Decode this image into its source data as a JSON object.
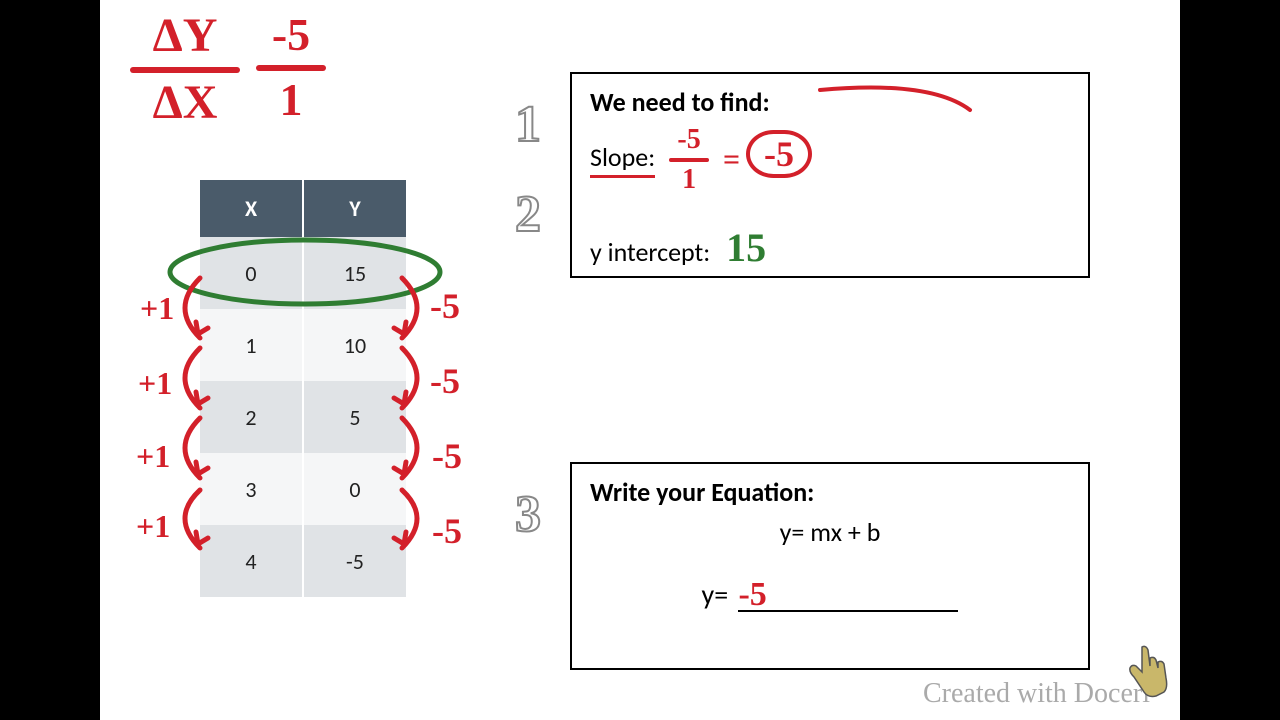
{
  "topLeftFraction": {
    "num1": "ΔY",
    "den1": "ΔX",
    "num2": "-5",
    "den2": "1"
  },
  "table": {
    "headers": {
      "x": "X",
      "y": "Y"
    },
    "rows": [
      {
        "x": "0",
        "y": "15"
      },
      {
        "x": "1",
        "y": "10"
      },
      {
        "x": "2",
        "y": "5"
      },
      {
        "x": "3",
        "y": "0"
      },
      {
        "x": "4",
        "y": "-5"
      }
    ]
  },
  "leftDeltas": [
    "+1",
    "+1",
    "+1",
    "+1"
  ],
  "rightDeltas": [
    "-5",
    "-5",
    "-5",
    "-5"
  ],
  "steps": {
    "one": "1",
    "two": "2",
    "three": "3"
  },
  "box1": {
    "title": "We need to find:",
    "slopeLabel": "Slope:",
    "slopeNum": "-5",
    "slopeDen": "1",
    "equals": "=",
    "slopeAnswer": "-5",
    "yIntLabel": "y intercept:",
    "yIntValue": "15"
  },
  "box3": {
    "title": "Write your Equation:",
    "line1": "y= mx + b",
    "line2prefix": "y= ",
    "line2answer": "-5"
  },
  "watermark": "Created with Doceri"
}
